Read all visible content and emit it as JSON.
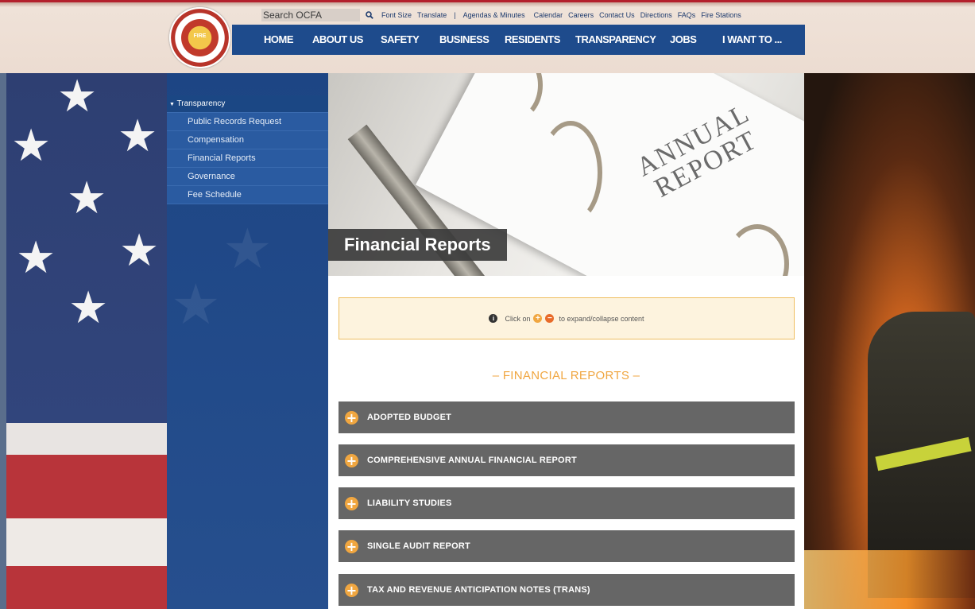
{
  "header": {
    "logo_text": "FIRE",
    "search": {
      "value": "Search OCFA",
      "icon": "search-icon"
    },
    "utility_links": [
      "Font Size",
      "Translate",
      "Agendas & Minutes",
      "Calendar",
      "Careers",
      "Contact Us",
      "Directions",
      "FAQs",
      "Fire Stations"
    ],
    "nav": [
      "HOME",
      "ABOUT US",
      "SAFETY",
      "BUSINESS",
      "RESIDENTS",
      "TRANSPARENCY",
      "JOBS",
      "I WANT TO ..."
    ]
  },
  "sidebar": {
    "heading": "Transparency",
    "items": [
      {
        "label": "Public Records Request"
      },
      {
        "label": "Compensation"
      },
      {
        "label": "Financial Reports"
      },
      {
        "label": "Governance"
      },
      {
        "label": "Fee Schedule"
      }
    ]
  },
  "hero": {
    "image_text_line1": "ANNUAL",
    "image_text_line2": "REPORT",
    "title": "Financial Reports"
  },
  "notice": {
    "prefix": "Click on",
    "suffix": "to expand/collapse content",
    "icons": [
      "info-icon",
      "expand-plus-icon",
      "collapse-minus-icon"
    ]
  },
  "section": {
    "title": "– FINANCIAL REPORTS –"
  },
  "accordion": [
    {
      "label": "ADOPTED BUDGET"
    },
    {
      "label": "COMPREHENSIVE ANNUAL FINANCIAL REPORT"
    },
    {
      "label": "LIABILITY STUDIES"
    },
    {
      "label": "SINGLE AUDIT REPORT"
    },
    {
      "label": "TAX AND REVENUE ANTICIPATION NOTES (TRANS)"
    }
  ],
  "colors": {
    "nav_blue": "#1e4b8c",
    "accent_orange": "#f0a640",
    "accordion_gray": "#666666",
    "notice_bg": "#fdf3de"
  }
}
